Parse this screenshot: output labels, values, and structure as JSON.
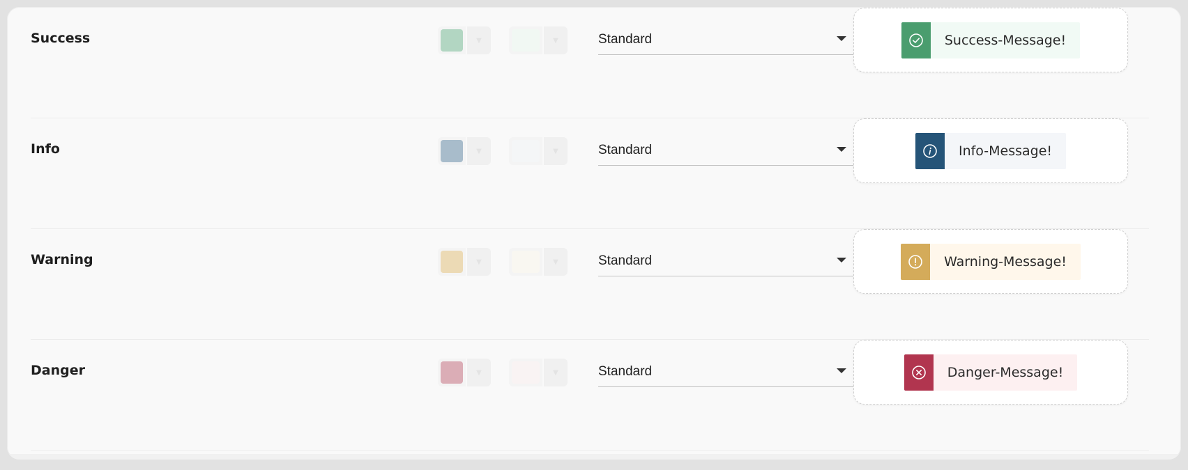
{
  "rows": [
    {
      "label": "Success",
      "select_value": "Standard",
      "icon": "check-circle-icon",
      "message": "Success-Message!",
      "colors": {
        "swatch_primary": "#b2d6c2",
        "swatch_secondary": "#f1f8f3",
        "accent": "#4a9d6e",
        "toast_bg": "#f1faf5"
      }
    },
    {
      "label": "Info",
      "select_value": "Standard",
      "icon": "info-circle-icon",
      "message": "Info-Message!",
      "colors": {
        "swatch_primary": "#a8bccb",
        "swatch_secondary": "#f4f6f7",
        "accent": "#255478",
        "toast_bg": "#f4f6f9"
      }
    },
    {
      "label": "Warning",
      "select_value": "Standard",
      "icon": "exclamation-circle-icon",
      "message": "Warning-Message!",
      "colors": {
        "swatch_primary": "#ecdab5",
        "swatch_secondary": "#f9f7f1",
        "accent": "#d4ab5a",
        "toast_bg": "#fff7eb"
      }
    },
    {
      "label": "Danger",
      "select_value": "Standard",
      "icon": "x-circle-icon",
      "message": "Danger-Message!",
      "colors": {
        "swatch_primary": "#dbadb6",
        "swatch_secondary": "#f9f3f3",
        "accent": "#b1354f",
        "toast_bg": "#fdf0f1"
      }
    }
  ]
}
